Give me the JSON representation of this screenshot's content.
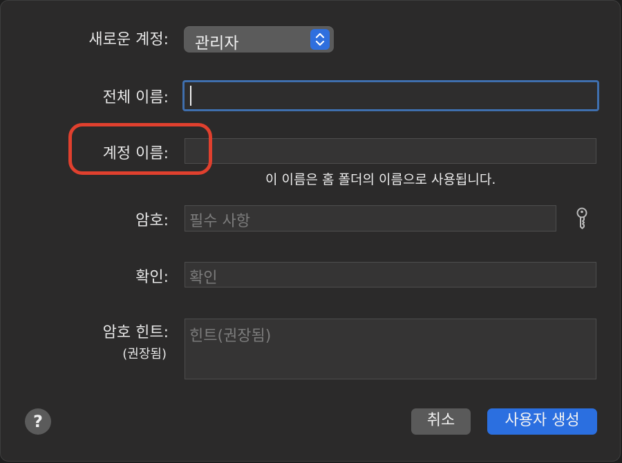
{
  "form": {
    "account_type": {
      "label": "새로운 계정:",
      "value": "관리자"
    },
    "full_name": {
      "label": "전체 이름:",
      "value": ""
    },
    "account_name": {
      "label": "계정 이름:",
      "value": "",
      "helper": "이 이름은 홈 폴더의 이름으로 사용됩니다."
    },
    "password": {
      "label": "암호:",
      "placeholder": "필수 사항",
      "icon": "key-icon"
    },
    "verify": {
      "label": "확인:",
      "placeholder": "확인"
    },
    "hint": {
      "label": "암호 힌트:",
      "sublabel": "(권장됨)",
      "placeholder": "힌트(권장됨)"
    }
  },
  "buttons": {
    "help": "?",
    "cancel": "취소",
    "create": "사용자 생성"
  },
  "colors": {
    "accent": "#2b6fe0",
    "highlight": "#e0402e",
    "focus_ring": "#3f6fae",
    "dialog_bg": "#2b2a2a"
  }
}
